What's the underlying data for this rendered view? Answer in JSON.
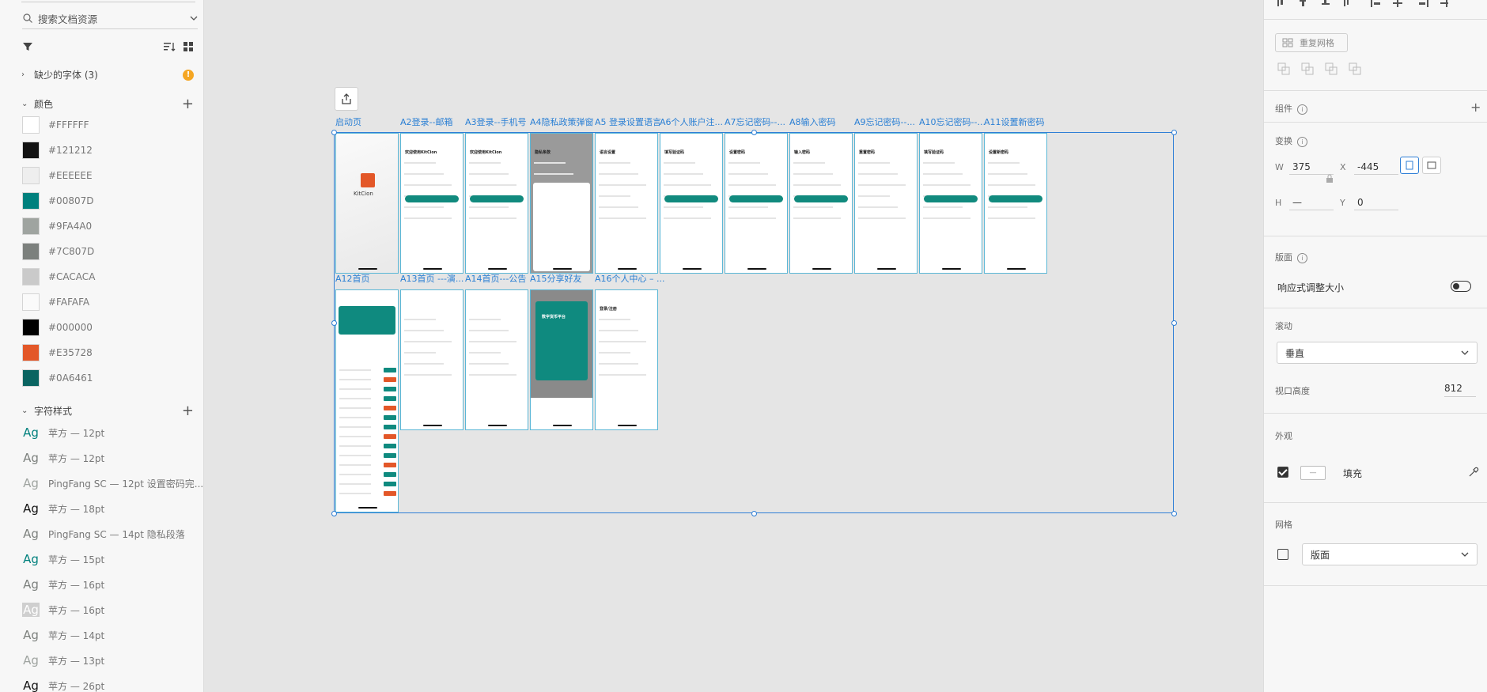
{
  "assets": {
    "search_placeholder": "搜索文档资源",
    "missing_fonts_label": "缺少的字体 (3)",
    "colors_title": "颜色",
    "colors": [
      {
        "hex": "#FFFFFF",
        "label": "#FFFFFF"
      },
      {
        "hex": "#121212",
        "label": "#121212"
      },
      {
        "hex": "#EEEEEE",
        "label": "#EEEEEE"
      },
      {
        "hex": "#00807D",
        "label": "#00807D"
      },
      {
        "hex": "#9FA4A0",
        "label": "#9FA4A0"
      },
      {
        "hex": "#7C807D",
        "label": "#7C807D"
      },
      {
        "hex": "#CACACA",
        "label": "#CACACA"
      },
      {
        "hex": "#FAFAFA",
        "label": "#FAFAFA"
      },
      {
        "hex": "#000000",
        "label": "#000000"
      },
      {
        "hex": "#E35728",
        "label": "#E35728"
      },
      {
        "hex": "#0A6461",
        "label": "#0A6461"
      }
    ],
    "char_styles_title": "字符样式",
    "char_styles": [
      {
        "ag": "Ag",
        "label": "苹方 — 12pt",
        "color": "#00807D"
      },
      {
        "ag": "Ag",
        "label": "苹方 — 12pt",
        "color": "#7C807D"
      },
      {
        "ag": "Ag",
        "label": "PingFang SC — 12pt 设置密码完...",
        "color": "#9FA4A0"
      },
      {
        "ag": "Ag",
        "label": "苹方 — 18pt",
        "color": "#121212"
      },
      {
        "ag": "Ag",
        "label": "PingFang SC — 14pt 隐私段落",
        "color": "#7C807D"
      },
      {
        "ag": "Ag",
        "label": "苹方 — 15pt",
        "color": "#00807D"
      },
      {
        "ag": "Ag",
        "label": "苹方 — 16pt",
        "color": "#7C807D"
      },
      {
        "ag": "Ag",
        "label": "苹方 — 16pt",
        "color": "#FFFFFF"
      },
      {
        "ag": "Ag",
        "label": "苹方 — 14pt",
        "color": "#7C807D"
      },
      {
        "ag": "Ag",
        "label": "苹方 — 13pt",
        "color": "#9FA4A0"
      },
      {
        "ag": "Ag",
        "label": "苹方 — 26pt",
        "color": "#121212"
      }
    ]
  },
  "canvas": {
    "artboards_row1": [
      {
        "label": "启动页"
      },
      {
        "label": "A2登录--邮箱"
      },
      {
        "label": "A3登录--手机号"
      },
      {
        "label": "A4隐私政策弹窗"
      },
      {
        "label": "A5 登录设置语言"
      },
      {
        "label": "A6个人账户注..."
      },
      {
        "label": "A7忘记密码--..."
      },
      {
        "label": "A8输入密码"
      },
      {
        "label": "A9忘记密码--..."
      },
      {
        "label": "A10忘记密码--..."
      },
      {
        "label": "A11设置新密码"
      }
    ],
    "artboards_row2": [
      {
        "label": "A12首页"
      },
      {
        "label": "A13首页 ---演..."
      },
      {
        "label": "A14首页---公告"
      },
      {
        "label": "A15分享好友"
      },
      {
        "label": "A16个人中心 – ..."
      }
    ],
    "launch_logo_text": "KitCion",
    "a2_title": "欢迎使用KitCion",
    "a3_title": "欢迎使用KitCion",
    "a4_title": "隐私条款",
    "a5_title": "语言设置",
    "a6_title": "填写验证码",
    "a7_title": "设置密码",
    "a8_title": "输入密码",
    "a9_title": "重置密码",
    "a10_title": "填写验证码",
    "a11_title": "设置新密码",
    "a15_title": "数字货币平台",
    "a16_title": "登录/注册"
  },
  "inspector": {
    "repeat_grid": "重复网格",
    "component_label": "组件",
    "transform_label": "变换",
    "w_label": "W",
    "w_value": "375",
    "x_label": "X",
    "x_value": "-445",
    "h_label": "H",
    "h_value": "—",
    "y_label": "Y",
    "y_value": "0",
    "layout_label": "版面",
    "responsive_label": "响应式调整大小",
    "scroll_label": "滚动",
    "scroll_value": "垂直",
    "viewport_label": "视口高度",
    "viewport_value": "812",
    "appearance_label": "外观",
    "fill_label": "填充",
    "grid_label": "网格",
    "grid_value": "版面"
  }
}
